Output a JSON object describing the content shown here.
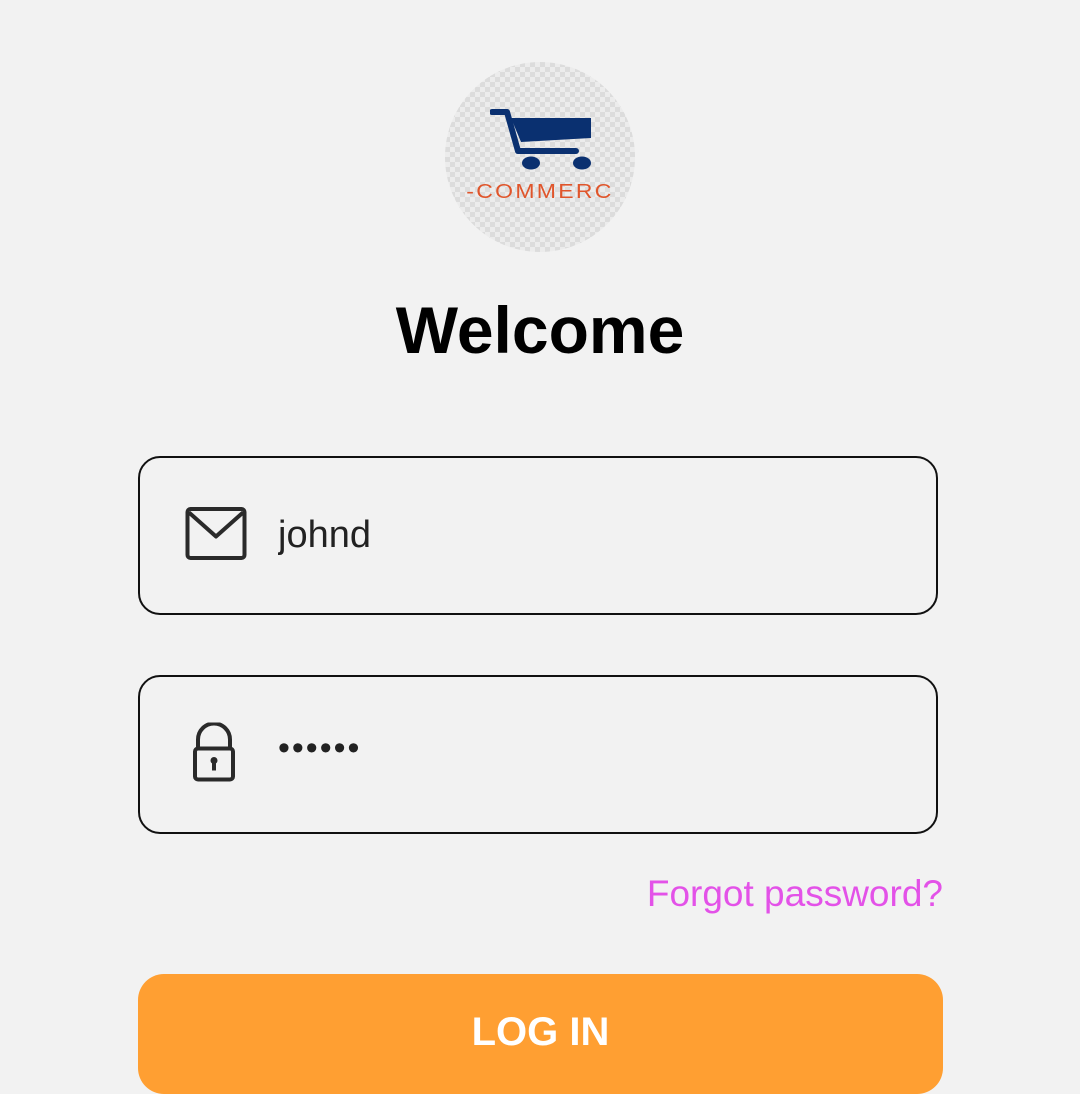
{
  "logo": {
    "text": "-COMMERC",
    "icon": "shopping-cart-icon",
    "cart_color": "#0a3070",
    "text_color": "#e0552b"
  },
  "title": "Welcome",
  "email_field": {
    "icon": "mail-icon",
    "value": "johnd"
  },
  "password_field": {
    "icon": "lock-icon",
    "value": "••••••"
  },
  "forgot_password": {
    "label": "Forgot password?",
    "color": "#e352e8"
  },
  "login_button": {
    "label": "LOG IN",
    "color": "#ff9f32"
  },
  "background_color": "#f2f2f2"
}
